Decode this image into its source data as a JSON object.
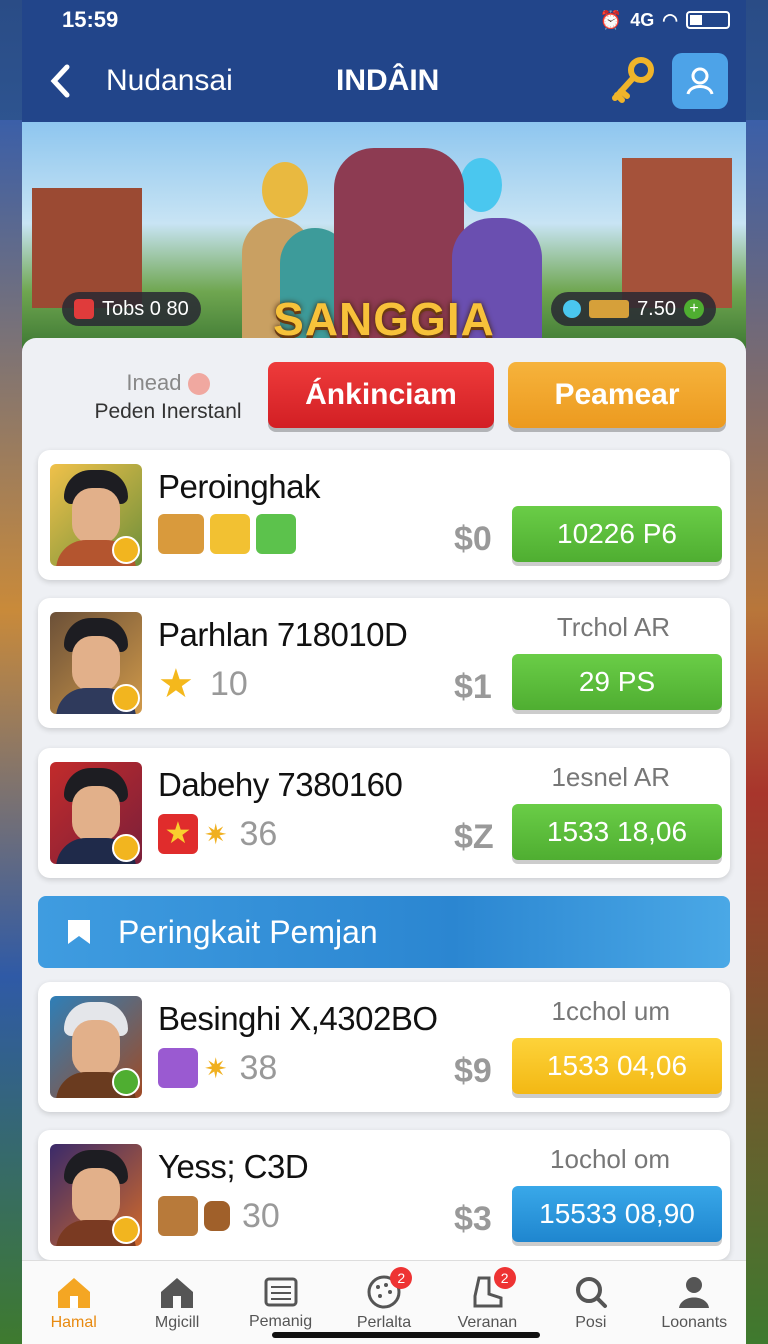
{
  "status_bar": {
    "time": "15:59",
    "signal_text": "4G"
  },
  "header": {
    "left_title": "Nudansai",
    "title": "INDÂIN"
  },
  "banner": {
    "title": "SANGGIA",
    "left_pill": "Tobs 0 80",
    "right_pill": "7.50"
  },
  "controls": {
    "label_top": "Inead",
    "label_bottom": "Peden Inerstanl",
    "button_red": "Ánkinciam",
    "button_orange": "Peamear"
  },
  "players": [
    {
      "name": "Peroinghak",
      "subtitle": "",
      "count": "",
      "price": "$0",
      "value": "10226 P6",
      "style": "green"
    },
    {
      "name": "Parhlan 718010D",
      "subtitle": "Trchol AR",
      "count": "10",
      "price": "$1",
      "value": "29 PS",
      "style": "green"
    },
    {
      "name": "Dabehy 7380160",
      "subtitle": "1esnel AR",
      "count": "36",
      "price": "$Z",
      "value": "1533 18,06",
      "style": "green"
    }
  ],
  "section": {
    "title": "Peringkait Pemjan"
  },
  "ranking": [
    {
      "name": "Besinghi X,4302BO",
      "subtitle": "1cchol um",
      "count": "38",
      "price": "$9",
      "value": "1533 04,06",
      "style": "yellow"
    },
    {
      "name": "Yess; C3D",
      "subtitle": "1ochol om",
      "count": "30",
      "price": "$3",
      "value": "15533 08,90",
      "style": "blue"
    }
  ],
  "nav": [
    {
      "label": "Hamal",
      "icon": "home-icon",
      "badge": ""
    },
    {
      "label": "Mgicill",
      "icon": "house-icon",
      "badge": ""
    },
    {
      "label": "Pemanig",
      "icon": "cash-register-icon",
      "badge": ""
    },
    {
      "label": "Perlalta",
      "icon": "globe-icon",
      "badge": "2"
    },
    {
      "label": "Veranan",
      "icon": "boot-icon",
      "badge": "2"
    },
    {
      "label": "Posi",
      "icon": "search-icon",
      "badge": ""
    },
    {
      "label": "Loonants",
      "icon": "user-icon",
      "badge": ""
    }
  ],
  "colors": {
    "accent_green": "#4fae31",
    "accent_yellow": "#f3b814",
    "accent_blue": "#1f86cf",
    "header_blue": "#22458a"
  }
}
